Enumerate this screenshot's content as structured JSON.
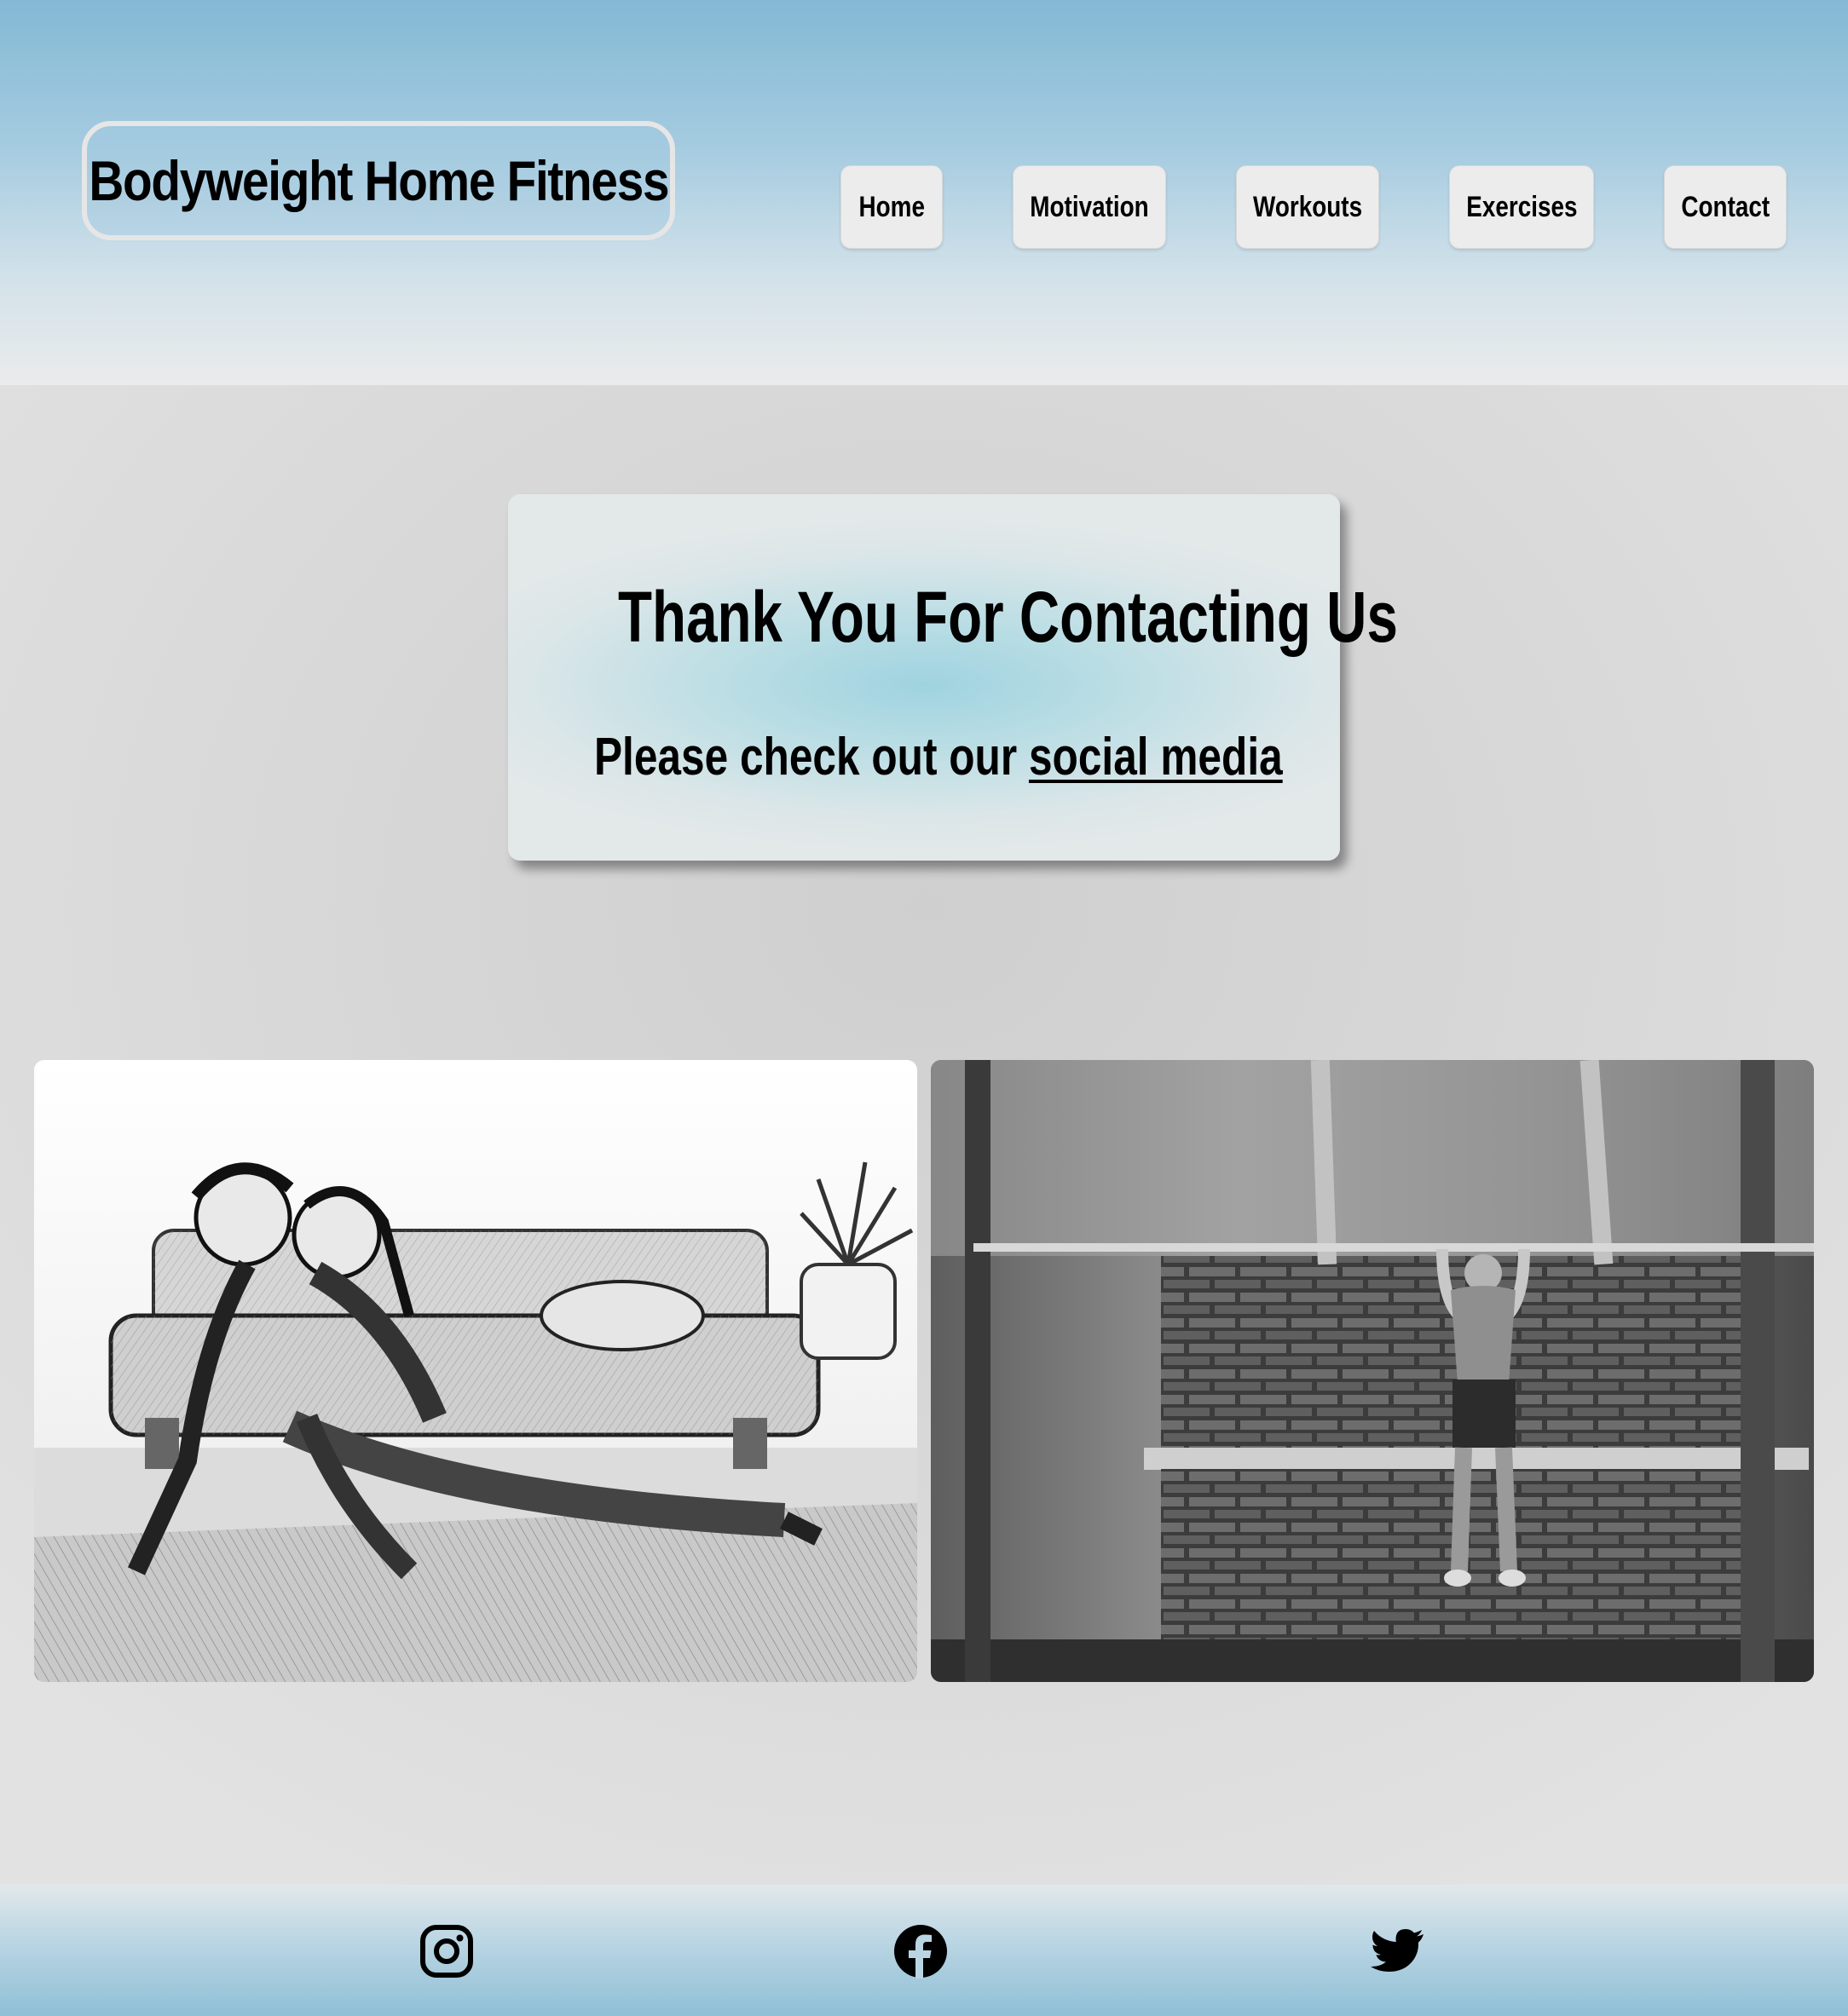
{
  "header": {
    "site_title": "Bodyweight Home Fitness",
    "nav": [
      {
        "label": "Home"
      },
      {
        "label": "Motivation"
      },
      {
        "label": "Workouts"
      },
      {
        "label": "Exercises"
      },
      {
        "label": "Contact"
      }
    ]
  },
  "main": {
    "heading": "Thank You For Contacting Us",
    "message_prefix": "Please check out our ",
    "message_link": "social media"
  },
  "images": [
    {
      "subject": "sketch of a woman and girl stretching on a rug in front of a sofa",
      "icon": "photo-icon"
    },
    {
      "subject": "sketch of a man doing pull-ups on a bar against a brick wall",
      "icon": "photo-icon"
    }
  ],
  "footer": {
    "social_icons": [
      "instagram-icon",
      "facebook-icon",
      "twitter-icon"
    ]
  },
  "colors": {
    "header_top": "#83b9d4",
    "card_accent": "#9fd3e0",
    "page_background": "#d9d9d9",
    "nav_button": "#ececec",
    "text": "#000000"
  }
}
